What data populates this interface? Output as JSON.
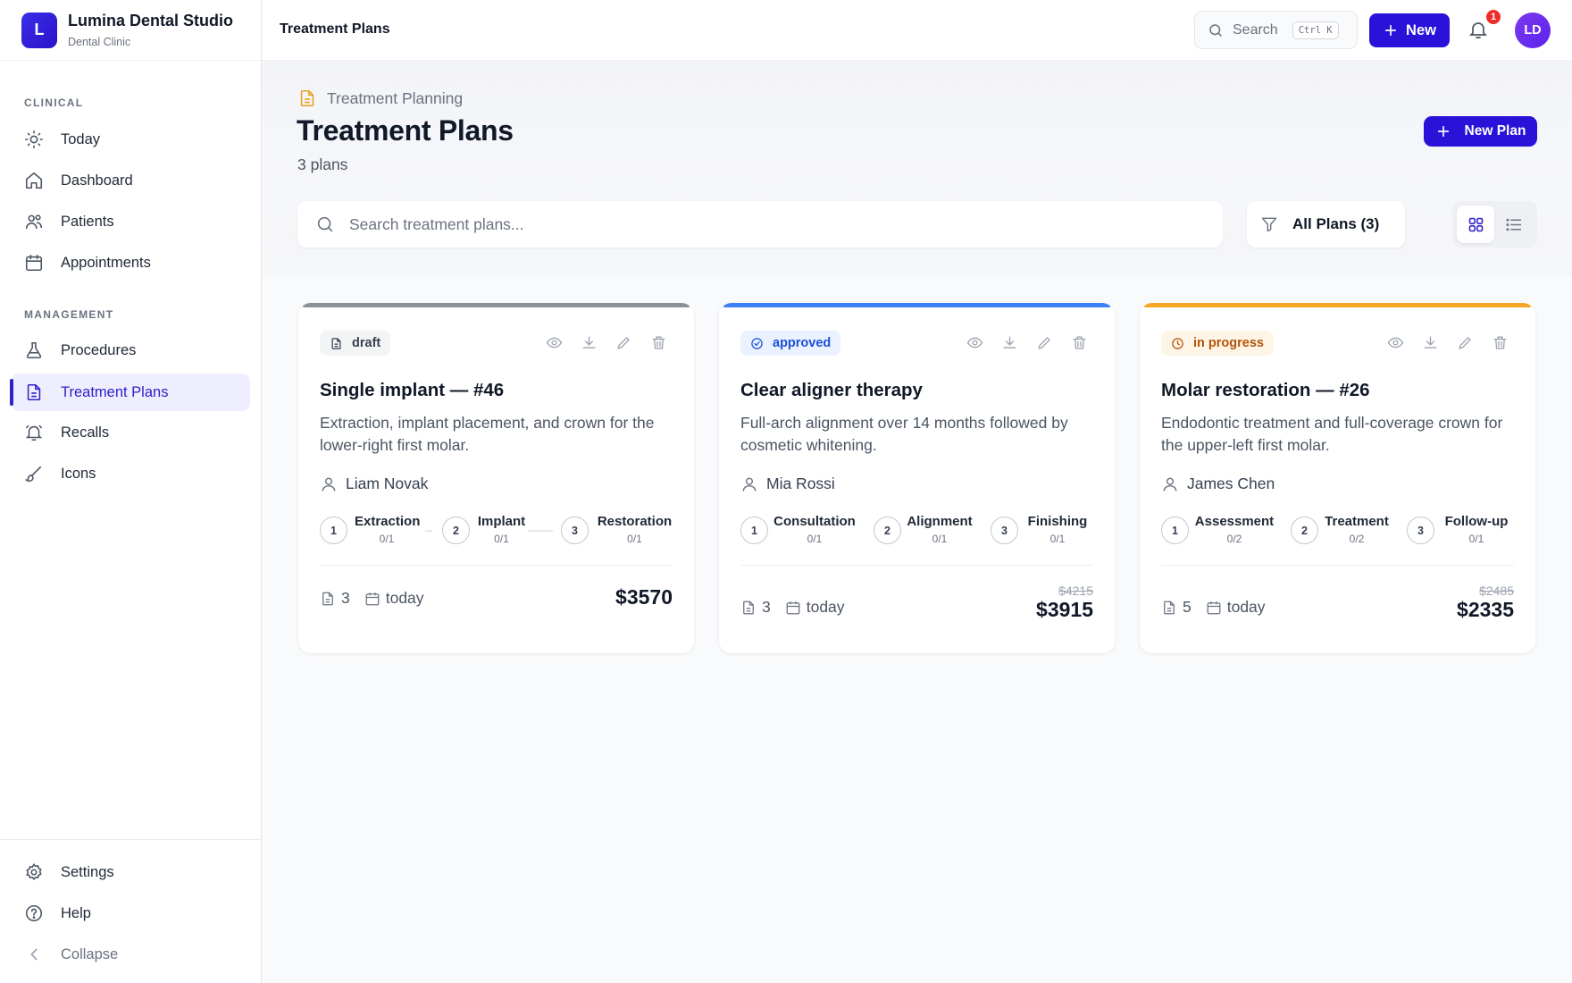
{
  "brand": {
    "logo_letter": "L",
    "name": "Lumina Dental Studio",
    "subtitle": "Dental Clinic"
  },
  "sidebar": {
    "sections": [
      {
        "label": "CLINICAL"
      },
      {
        "label": "MANAGEMENT"
      }
    ],
    "items": [
      {
        "label": "Today",
        "icon": "sun-icon"
      },
      {
        "label": "Dashboard",
        "icon": "home-icon"
      },
      {
        "label": "Patients",
        "icon": "users-icon"
      },
      {
        "label": "Appointments",
        "icon": "calendar-icon"
      },
      {
        "label": "Procedures",
        "icon": "flask-icon"
      },
      {
        "label": "Treatment Plans",
        "icon": "document-icon",
        "active": true
      },
      {
        "label": "Recalls",
        "icon": "bell-ring-icon"
      },
      {
        "label": "Icons",
        "icon": "brush-icon"
      }
    ],
    "bottom": [
      {
        "label": "Settings",
        "icon": "gear-icon"
      },
      {
        "label": "Help",
        "icon": "help-circle-icon"
      },
      {
        "label": "Collapse",
        "icon": "chevron-left-icon"
      }
    ]
  },
  "topbar": {
    "title": "Treatment Plans",
    "search_label": "Search",
    "search_shortcut": "Ctrl K",
    "new_label": "New",
    "notification_count": "1",
    "avatar_initials": "LD"
  },
  "header": {
    "breadcrumb": "Treatment Planning",
    "title": "Treatment Plans",
    "count": "3 plans",
    "new_plan_label": "New Plan",
    "search_placeholder": "Search treatment plans...",
    "filter_label": "All Plans (3)"
  },
  "colors": {
    "accent": "#2a12d9",
    "draft": "#8b9099",
    "approved": "#3b82f6",
    "in_progress": "#f5a623"
  },
  "plans": [
    {
      "status": "draft",
      "title": "Single implant — #46",
      "description": "Extraction, implant placement, and crown for the lower-right first molar.",
      "patient": "Liam Novak",
      "steps": [
        {
          "num": "1",
          "name": "Extraction",
          "progress": "0/1"
        },
        {
          "num": "2",
          "name": "Implant",
          "progress": "0/1"
        },
        {
          "num": "3",
          "name": "Restoration",
          "progress": "0/1"
        }
      ],
      "documents": "3",
      "date": "today",
      "price": "$3570",
      "original_price": ""
    },
    {
      "status": "approved",
      "title": "Clear aligner therapy",
      "description": "Full-arch alignment over 14 months followed by cosmetic whitening.",
      "patient": "Mia Rossi",
      "steps": [
        {
          "num": "1",
          "name": "Consultation",
          "progress": "0/1"
        },
        {
          "num": "2",
          "name": "Alignment",
          "progress": "0/1"
        },
        {
          "num": "3",
          "name": "Finishing",
          "progress": "0/1"
        }
      ],
      "documents": "3",
      "date": "today",
      "price": "$3915",
      "original_price": "$4215"
    },
    {
      "status": "in progress",
      "title": "Molar restoration — #26",
      "description": "Endodontic treatment and full-coverage crown for the upper-left first molar.",
      "patient": "James Chen",
      "steps": [
        {
          "num": "1",
          "name": "Assessment",
          "progress": "0/2"
        },
        {
          "num": "2",
          "name": "Treatment",
          "progress": "0/2"
        },
        {
          "num": "3",
          "name": "Follow-up",
          "progress": "0/1"
        }
      ],
      "documents": "5",
      "date": "today",
      "price": "$2335",
      "original_price": "$2485"
    }
  ]
}
